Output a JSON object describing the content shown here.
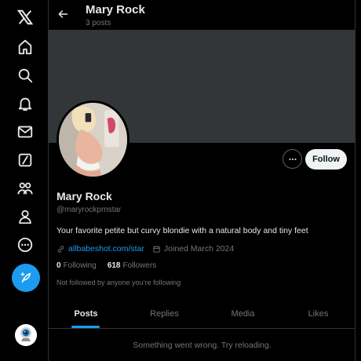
{
  "colors": {
    "background": "#000000",
    "banner": "#333639",
    "accent": "#1d9bf0",
    "text_primary": "#e7e9ea",
    "text_secondary": "#71767b",
    "follow_button_bg": "#eff3f4",
    "border": "#2f3336"
  },
  "nav": {
    "items": [
      {
        "icon": "x-logo-icon"
      },
      {
        "icon": "home-icon"
      },
      {
        "icon": "search-icon"
      },
      {
        "icon": "bell-icon"
      },
      {
        "icon": "mail-icon"
      },
      {
        "icon": "grok-icon"
      },
      {
        "icon": "communities-icon"
      },
      {
        "icon": "profile-icon"
      },
      {
        "icon": "more-circle-icon"
      }
    ],
    "compose_icon": "feather-icon"
  },
  "header": {
    "title": "Mary Rock",
    "post_count": "3 posts"
  },
  "profile": {
    "name": "Mary Rock",
    "handle": "@maryrockprnstar",
    "bio": "Your favorite petite but curvy blondie with a natural body and tiny feet",
    "link": "allbabeshot.com/star",
    "joined": "Joined March 2024",
    "following_count": "0",
    "following_label": "Following",
    "followers_count": "618",
    "followers_label": "Followers",
    "followed_by_note": "Not followed by anyone you’re following"
  },
  "actions": {
    "follow_label": "Follow"
  },
  "tabs": [
    {
      "label": "Posts",
      "active": true
    },
    {
      "label": "Replies",
      "active": false
    },
    {
      "label": "Media",
      "active": false
    },
    {
      "label": "Likes",
      "active": false
    }
  ],
  "feed": {
    "error_message": "Something went wrong. Try reloading."
  }
}
